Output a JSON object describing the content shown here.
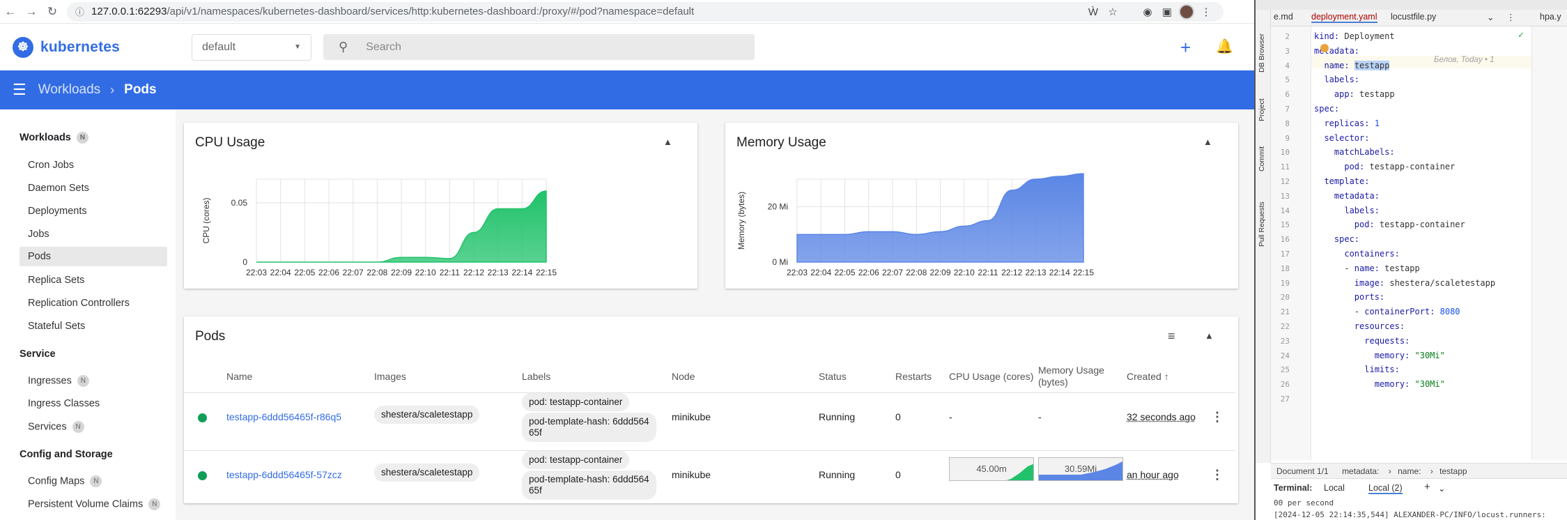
{
  "browser": {
    "url_host": "127.0.0.1:62293",
    "url_path": "/api/v1/namespaces/kubernetes-dashboard/services/http:kubernetes-dashboard:/proxy/#/pod?namespace=default"
  },
  "header": {
    "brand": "kubernetes",
    "namespace": "default",
    "search_placeholder": "Search"
  },
  "breadcrumb": {
    "parent": "Workloads",
    "current": "Pods"
  },
  "sidebar": {
    "workloads_title": "Workloads",
    "workloads_badge": "N",
    "workloads": [
      "Cron Jobs",
      "Daemon Sets",
      "Deployments",
      "Jobs",
      "Pods",
      "Replica Sets",
      "Replication Controllers",
      "Stateful Sets"
    ],
    "service_title": "Service",
    "service": [
      "Ingresses",
      "Ingress Classes",
      "Services"
    ],
    "config_title": "Config and Storage",
    "config": [
      "Config Maps",
      "Persistent Volume Claims"
    ],
    "badge": "N"
  },
  "cpu_card": {
    "title": "CPU Usage"
  },
  "mem_card": {
    "title": "Memory Usage"
  },
  "chart_data": [
    {
      "type": "area",
      "title": "CPU Usage",
      "xlabel": "",
      "ylabel": "CPU (cores)",
      "x": [
        "22:03",
        "22:04",
        "22:05",
        "22:06",
        "22:07",
        "22:08",
        "22:09",
        "22:10",
        "22:11",
        "22:12",
        "22:13",
        "22:14",
        "22:15"
      ],
      "values": [
        0,
        0,
        0,
        0,
        0,
        0,
        0.004,
        0.004,
        0.003,
        0.025,
        0.045,
        0.045,
        0.06
      ],
      "yticks": [
        "0",
        "0.05"
      ],
      "ylim": [
        0,
        0.07
      ],
      "color": "#21c26b",
      "grid": true
    },
    {
      "type": "area",
      "title": "Memory Usage",
      "xlabel": "",
      "ylabel": "Memory (bytes)",
      "x": [
        "22:03",
        "22:04",
        "22:05",
        "22:06",
        "22:07",
        "22:08",
        "22:09",
        "22:10",
        "22:11",
        "22:12",
        "22:13",
        "22:14",
        "22:15"
      ],
      "values": [
        10,
        10,
        10,
        11,
        11,
        10,
        11,
        13,
        15,
        26,
        30,
        31,
        32
      ],
      "yticks": [
        "0 Mi",
        "20 Mi"
      ],
      "ylim": [
        0,
        30
      ],
      "color": "#5b86e5",
      "grid": true
    }
  ],
  "pods": {
    "title": "Pods",
    "columns": [
      "Name",
      "Images",
      "Labels",
      "Node",
      "Status",
      "Restarts",
      "CPU Usage (cores)",
      "Memory Usage",
      "(bytes)",
      "Created"
    ],
    "rows": [
      {
        "name": "testapp-6ddd56465f-r86q5",
        "image": "shestera/scaletestapp",
        "label1": "pod: testapp-container",
        "label2a": "pod-template-hash: 6ddd564",
        "label2b": "65f",
        "node": "minikube",
        "status": "Running",
        "restarts": "0",
        "cpu": "-",
        "mem": "-",
        "created": "32 seconds ago"
      },
      {
        "name": "testapp-6ddd56465f-57zcz",
        "image": "shestera/scaletestapp",
        "label1": "pod: testapp-container",
        "label2a": "pod-template-hash: 6ddd564",
        "label2b": "65f",
        "node": "minikube",
        "status": "Running",
        "restarts": "0",
        "cpu": "45.00m",
        "mem": "30.59Mi",
        "created": "an hour ago"
      }
    ]
  },
  "ide": {
    "tabs": [
      "e.md",
      "deployment.yaml",
      "locustfile.py",
      "hpa.y"
    ],
    "side_tabs": [
      "DB Browser",
      "Project",
      "Commit",
      "Pull Requests"
    ],
    "inline_hint": "Белов, Today • 1",
    "lines": [
      {
        "n": "2",
        "t": "kind: Deployment"
      },
      {
        "n": "3",
        "t": "metadata:"
      },
      {
        "n": "4",
        "t": "  name: testapp"
      },
      {
        "n": "5",
        "t": "  labels:"
      },
      {
        "n": "6",
        "t": "    app: testapp"
      },
      {
        "n": "7",
        "t": "spec:"
      },
      {
        "n": "8",
        "t": "  replicas: 1"
      },
      {
        "n": "9",
        "t": "  selector:"
      },
      {
        "n": "10",
        "t": "    matchLabels:"
      },
      {
        "n": "11",
        "t": "      pod: testapp-container"
      },
      {
        "n": "12",
        "t": "  template:"
      },
      {
        "n": "13",
        "t": "    metadata:"
      },
      {
        "n": "14",
        "t": "      labels:"
      },
      {
        "n": "15",
        "t": "        pod: testapp-container"
      },
      {
        "n": "16",
        "t": "    spec:"
      },
      {
        "n": "17",
        "t": "      containers:"
      },
      {
        "n": "18",
        "t": "      - name: testapp"
      },
      {
        "n": "19",
        "t": "        image: shestera/scaletestapp"
      },
      {
        "n": "20",
        "t": "        ports:"
      },
      {
        "n": "21",
        "t": "        - containerPort: 8080"
      },
      {
        "n": "22",
        "t": "        resources:"
      },
      {
        "n": "23",
        "t": "          requests:"
      },
      {
        "n": "24",
        "t": "            memory: \"30Mi\""
      },
      {
        "n": "25",
        "t": "          limits:"
      },
      {
        "n": "26",
        "t": "            memory: \"30Mi\""
      },
      {
        "n": "27",
        "t": ""
      }
    ],
    "breadcrumb": [
      "Document 1/1",
      "metadata:",
      "name:",
      "testapp"
    ],
    "terminal_label": "Terminal:",
    "terminal_tabs": [
      "Local",
      "Local (2)"
    ],
    "terminal_lines": [
      "00 per second",
      "[2024-12-05 22:14:35,544] ALEXANDER-PC/INFO/locust.runners:"
    ]
  }
}
